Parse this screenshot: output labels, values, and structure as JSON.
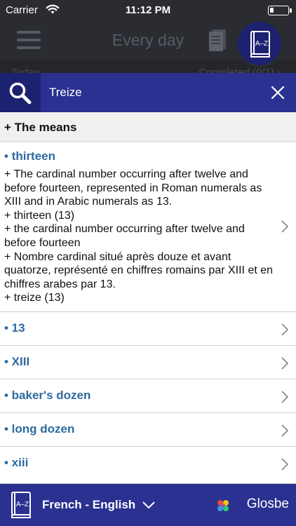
{
  "status_bar": {
    "carrier": "Carrier",
    "time": "11:12 PM"
  },
  "app_header": {
    "title": "Every day"
  },
  "underlay": {
    "left": "Today",
    "right": "Completed (0/1) ›"
  },
  "search": {
    "query": "Treize"
  },
  "section": {
    "title": "+ The means"
  },
  "entries": [
    {
      "term": "• thirteen",
      "definitions": [
        "+ The cardinal number occurring after twelve and before fourteen, represented in Roman numerals as XIII and in Arabic numerals as 13.",
        "+ thirteen (13)",
        "+ the cardinal number occurring after twelve and before fourteen",
        "+ Nombre cardinal situé après douze et avant quatorze, représenté en chiffres romains par XIII et en chiffres arabes par 13.",
        "+ treize (13)"
      ]
    },
    {
      "term": "• 13"
    },
    {
      "term": "• XIII"
    },
    {
      "term": "• baker's dozen"
    },
    {
      "term": "• long dozen"
    },
    {
      "term": "• xiii"
    }
  ],
  "bottom_bar": {
    "language_pair": "French - English",
    "brand": "Glosbe",
    "dictionary_icon_text": "A–Z"
  },
  "icons": [
    "wifi-icon",
    "battery-icon",
    "menu-icon",
    "document-icon",
    "dictionary-icon",
    "search-icon",
    "close-icon",
    "chevron-right-icon",
    "chevron-down-icon",
    "glosbe-logo-icon"
  ],
  "colors": {
    "accent": "#2a3190",
    "accent_dark": "#1d2270",
    "term": "#2d6aa0",
    "header_bg": "#2b2c31"
  }
}
